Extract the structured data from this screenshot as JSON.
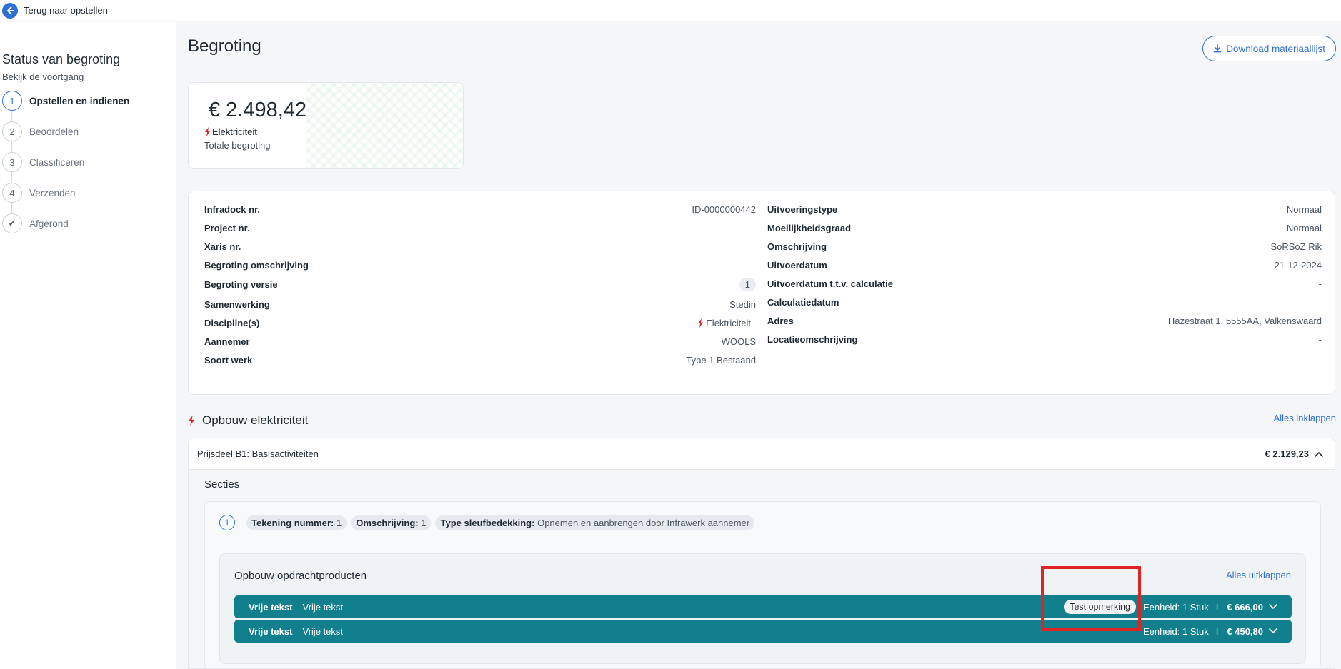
{
  "topbar": {
    "back_label": "Terug naar opstellen"
  },
  "sidebar": {
    "title": "Status van begroting",
    "subtitle": "Bekijk de voortgang",
    "steps": [
      {
        "number": "1",
        "label": "Opstellen en indienen",
        "active": true
      },
      {
        "number": "2",
        "label": "Beoordelen",
        "active": false
      },
      {
        "number": "3",
        "label": "Classificeren",
        "active": false
      },
      {
        "number": "4",
        "label": "Verzenden",
        "active": false
      },
      {
        "number": "✔",
        "label": "Afgerond",
        "active": false
      }
    ]
  },
  "main": {
    "title": "Begroting",
    "download_label": "Download materiaallijst",
    "total": {
      "amount": "€ 2.498,42",
      "discipline": "Elektriciteit",
      "label": "Totale begroting"
    },
    "info_left": [
      {
        "key": "Infradock nr.",
        "value": "ID-0000000442"
      },
      {
        "key": "Project nr.",
        "value": ""
      },
      {
        "key": "Xaris nr.",
        "value": ""
      },
      {
        "key": "Begroting omschrijving",
        "value": "-"
      },
      {
        "key": "Begroting versie",
        "value": "1"
      },
      {
        "key": "Samenwerking",
        "value": "Stedin"
      },
      {
        "key": "Discipline(s)",
        "value": "Elektriciteit"
      },
      {
        "key": "Aannemer",
        "value": "WOOLS"
      },
      {
        "key": "Soort werk",
        "value": "Type 1 Bestaand"
      }
    ],
    "info_right": [
      {
        "key": "Uitvoeringstype",
        "value": "Normaal"
      },
      {
        "key": "Moeilijkheidsgraad",
        "value": "Normaal"
      },
      {
        "key": "Omschrijving",
        "value": "SoRSoZ Rik"
      },
      {
        "key": "Uitvoerdatum",
        "value": "21-12-2024"
      },
      {
        "key": "Uitvoerdatum t.t.v. calculatie",
        "value": "-"
      },
      {
        "key": "Calculatiedatum",
        "value": "-"
      },
      {
        "key": "Adres",
        "value": "Hazestraat 1, 5555AA, Valkenswaard"
      },
      {
        "key": "Locatieomschrijving",
        "value": "-"
      }
    ],
    "section": {
      "title": "Opbouw elektriciteit",
      "collapse_all": "Alles inklappen",
      "prijsdeel": {
        "title": "Prijsdeel B1: Basisactiviteiten",
        "amount": "€ 2.129,23",
        "secties_label": "Secties",
        "sectie": {
          "number": "1",
          "tags": [
            {
              "label": "Tekening nummer:",
              "value": "1"
            },
            {
              "label": "Omschrijving:",
              "value": "1"
            },
            {
              "label": "Type sleufbedekking:",
              "value": "Opnemen en aanbrengen door Infrawerk aannemer"
            }
          ],
          "products_title": "Opbouw opdrachtproducten",
          "expand_all": "Alles uitklappen",
          "products": [
            {
              "name": "Vrije tekst",
              "description": "Vrije tekst",
              "remark": "Test opmerking",
              "unit": "Eenheid: 1 Stuk",
              "separator": "I",
              "price": "€ 666,00"
            },
            {
              "name": "Vrije tekst",
              "description": "Vrije tekst",
              "remark": "",
              "unit": "Eenheid: 1 Stuk",
              "separator": "I",
              "price": "€ 450,80"
            }
          ]
        }
      }
    }
  },
  "colors": {
    "accent": "#2f6fd6",
    "product_row": "#127f8c",
    "discipline_icon": "#d62828",
    "highlight": "#e02424"
  }
}
